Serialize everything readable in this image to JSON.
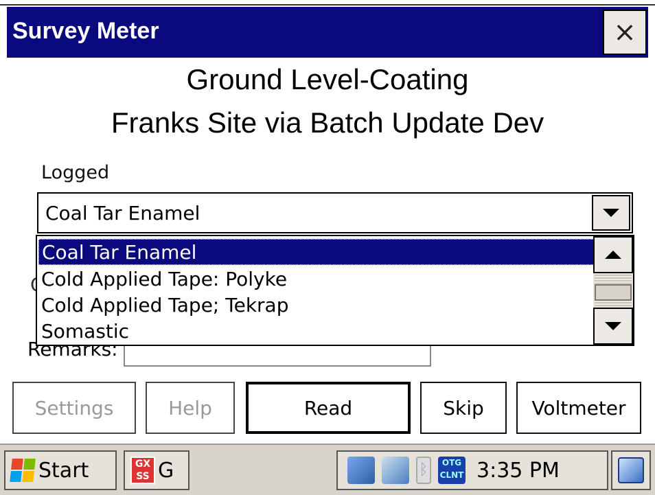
{
  "window": {
    "title": "Survey Meter",
    "close_label": "×"
  },
  "headings": {
    "line1": "Ground Level-Coating",
    "line2": "Franks Site via Batch Update Dev"
  },
  "logged": {
    "label": "Logged",
    "selected_value": "Coal Tar Enamel",
    "options": [
      "Coal Tar Enamel",
      "Cold Applied Tape: Polyke",
      "Cold Applied Tape; Tekrap",
      "Somastic"
    ]
  },
  "partial": {
    "hidden_label_char": "C"
  },
  "remarks": {
    "label": "Remarks:",
    "value": ""
  },
  "buttons": {
    "settings": "Settings",
    "help": "Help",
    "read": "Read",
    "skip": "Skip",
    "voltmeter": "Voltmeter"
  },
  "taskbar": {
    "start_label": "Start",
    "app_label": "G",
    "app_icon_text": "GX SS",
    "otg_icon_text": "OTG CLNT",
    "time": "3:35 PM"
  },
  "colors": {
    "titlebar": "#0a0a7e",
    "selection": "#0a0a7e",
    "taskbar": "#d8d4cc"
  }
}
